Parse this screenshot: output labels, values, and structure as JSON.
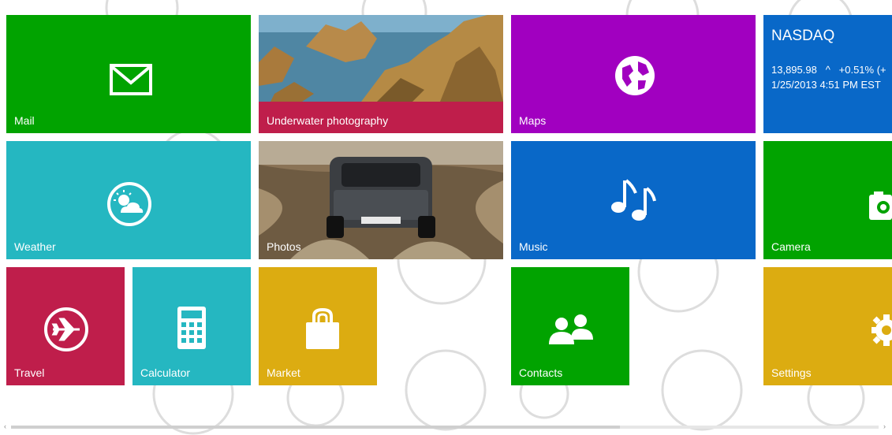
{
  "colors": {
    "green": "#01a300",
    "crimson": "#bf1e4b",
    "purple": "#a100c0",
    "blue": "#0968c8",
    "teal": "#25b7c1",
    "gold": "#dcac11"
  },
  "tiles": {
    "mail": {
      "label": "Mail",
      "icon": "envelope-icon"
    },
    "underwater": {
      "label": "Underwater photography"
    },
    "maps": {
      "label": "Maps",
      "icon": "globe-icon"
    },
    "nasdaq": {
      "title": "NASDAQ",
      "value": "13,895.98",
      "arrow": "^",
      "change": "+0.51% (+",
      "timestamp": "1/25/2013 4:51 PM EST"
    },
    "weather": {
      "label": "Weather",
      "icon": "sun-cloud-icon"
    },
    "photos": {
      "label": "Photos"
    },
    "music": {
      "label": "Music",
      "icon": "music-note-icon"
    },
    "camera": {
      "label": "Camera",
      "icon": "camera-icon"
    },
    "travel": {
      "label": "Travel",
      "icon": "airplane-icon"
    },
    "calculator": {
      "label": "Calculator",
      "icon": "calculator-icon"
    },
    "market": {
      "label": "Market",
      "icon": "shopping-bag-icon"
    },
    "contacts": {
      "label": "Contacts",
      "icon": "people-icon"
    },
    "settings": {
      "label": "Settings",
      "icon": "gear-icon"
    }
  },
  "scrollbar": {
    "left_arrow": "‹",
    "right_arrow": "›"
  }
}
